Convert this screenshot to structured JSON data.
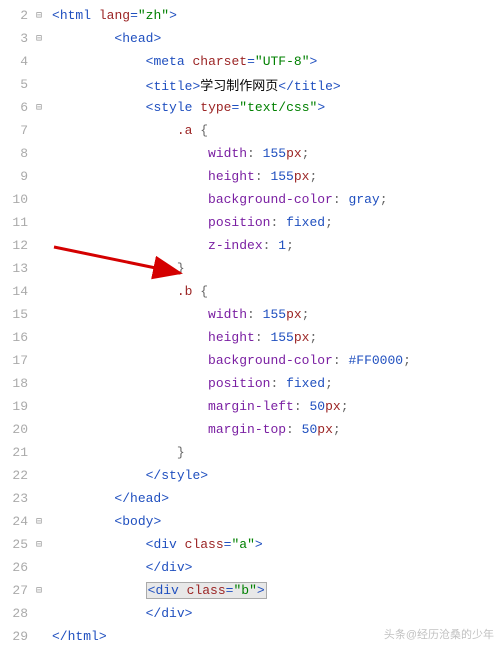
{
  "watermark": "头条@经历沧桑的少年",
  "lines": [
    {
      "num": "2",
      "fold": "⊟",
      "tokens": [
        [
          "",
          "<"
        ],
        [
          "tag",
          "html"
        ],
        [
          "",
          " "
        ],
        [
          "attr",
          "lang"
        ],
        [
          "",
          "="
        ],
        [
          "str",
          "\"zh\""
        ],
        [
          "",
          ">"
        ]
      ]
    },
    {
      "num": "3",
      "fold": "⊟",
      "indent": 2,
      "tokens": [
        [
          "",
          "<"
        ],
        [
          "tag",
          "head"
        ],
        [
          "",
          ">"
        ]
      ]
    },
    {
      "num": "4",
      "fold": "",
      "indent": 3,
      "tokens": [
        [
          "",
          "<"
        ],
        [
          "tag",
          "meta"
        ],
        [
          "",
          " "
        ],
        [
          "attr",
          "charset"
        ],
        [
          "",
          "="
        ],
        [
          "str",
          "\"UTF-8\""
        ],
        [
          "",
          ">"
        ]
      ]
    },
    {
      "num": "5",
      "fold": "",
      "indent": 3,
      "tokens": [
        [
          "",
          "<"
        ],
        [
          "tag",
          "title"
        ],
        [
          "",
          ">"
        ],
        [
          "text",
          "学习制作网页"
        ],
        [
          "",
          "</"
        ],
        [
          "tag",
          "title"
        ],
        [
          "",
          ">"
        ]
      ]
    },
    {
      "num": "6",
      "fold": "⊟",
      "indent": 3,
      "tokens": [
        [
          "",
          "<"
        ],
        [
          "tag",
          "style"
        ],
        [
          "",
          " "
        ],
        [
          "attr",
          "type"
        ],
        [
          "",
          "="
        ],
        [
          "str",
          "\"text/css\""
        ],
        [
          "",
          ">"
        ]
      ]
    },
    {
      "num": "7",
      "fold": "",
      "indent": 4,
      "tokens": [
        [
          "sel",
          ".a"
        ],
        [
          "",
          " "
        ],
        [
          "brace",
          "{"
        ]
      ]
    },
    {
      "num": "8",
      "fold": "",
      "indent": 5,
      "tokens": [
        [
          "prop",
          "width"
        ],
        [
          "colon",
          ": "
        ],
        [
          "val",
          "155"
        ],
        [
          "unit",
          "px"
        ],
        [
          "colon",
          ";"
        ]
      ]
    },
    {
      "num": "9",
      "fold": "",
      "indent": 5,
      "tokens": [
        [
          "prop",
          "height"
        ],
        [
          "colon",
          ": "
        ],
        [
          "val",
          "155"
        ],
        [
          "unit",
          "px"
        ],
        [
          "colon",
          ";"
        ]
      ]
    },
    {
      "num": "10",
      "fold": "",
      "indent": 5,
      "tokens": [
        [
          "prop",
          "background-color"
        ],
        [
          "colon",
          ": "
        ],
        [
          "val",
          "gray"
        ],
        [
          "colon",
          ";"
        ]
      ]
    },
    {
      "num": "11",
      "fold": "",
      "indent": 5,
      "tokens": [
        [
          "prop",
          "position"
        ],
        [
          "colon",
          ": "
        ],
        [
          "val",
          "fixed"
        ],
        [
          "colon",
          ";"
        ]
      ]
    },
    {
      "num": "12",
      "fold": "",
      "indent": 5,
      "tokens": [
        [
          "prop",
          "z-index"
        ],
        [
          "colon",
          ": "
        ],
        [
          "val",
          "1"
        ],
        [
          "colon",
          ";"
        ]
      ]
    },
    {
      "num": "13",
      "fold": "",
      "indent": 4,
      "tokens": [
        [
          "brace",
          "}"
        ]
      ]
    },
    {
      "num": "14",
      "fold": "",
      "indent": 4,
      "tokens": [
        [
          "sel",
          ".b"
        ],
        [
          "",
          " "
        ],
        [
          "brace",
          "{"
        ]
      ]
    },
    {
      "num": "15",
      "fold": "",
      "indent": 5,
      "tokens": [
        [
          "prop",
          "width"
        ],
        [
          "colon",
          ": "
        ],
        [
          "val",
          "155"
        ],
        [
          "unit",
          "px"
        ],
        [
          "colon",
          ";"
        ]
      ]
    },
    {
      "num": "16",
      "fold": "",
      "indent": 5,
      "tokens": [
        [
          "prop",
          "height"
        ],
        [
          "colon",
          ": "
        ],
        [
          "val",
          "155"
        ],
        [
          "unit",
          "px"
        ],
        [
          "colon",
          ";"
        ]
      ]
    },
    {
      "num": "17",
      "fold": "",
      "indent": 5,
      "tokens": [
        [
          "prop",
          "background-color"
        ],
        [
          "colon",
          ": "
        ],
        [
          "val",
          "#FF0000"
        ],
        [
          "colon",
          ";"
        ]
      ]
    },
    {
      "num": "18",
      "fold": "",
      "indent": 5,
      "tokens": [
        [
          "prop",
          "position"
        ],
        [
          "colon",
          ": "
        ],
        [
          "val",
          "fixed"
        ],
        [
          "colon",
          ";"
        ]
      ]
    },
    {
      "num": "19",
      "fold": "",
      "indent": 5,
      "tokens": [
        [
          "prop",
          "margin-left"
        ],
        [
          "colon",
          ": "
        ],
        [
          "val",
          "50"
        ],
        [
          "unit",
          "px"
        ],
        [
          "colon",
          ";"
        ]
      ]
    },
    {
      "num": "20",
      "fold": "",
      "indent": 5,
      "tokens": [
        [
          "prop",
          "margin-top"
        ],
        [
          "colon",
          ": "
        ],
        [
          "val",
          "50"
        ],
        [
          "unit",
          "px"
        ],
        [
          "colon",
          ";"
        ]
      ]
    },
    {
      "num": "21",
      "fold": "",
      "indent": 4,
      "tokens": [
        [
          "brace",
          "}"
        ]
      ]
    },
    {
      "num": "22",
      "fold": "",
      "indent": 3,
      "tokens": [
        [
          "",
          "</"
        ],
        [
          "tag",
          "style"
        ],
        [
          "",
          ">"
        ]
      ]
    },
    {
      "num": "23",
      "fold": "",
      "indent": 2,
      "tokens": [
        [
          "",
          "</"
        ],
        [
          "tag",
          "head"
        ],
        [
          "",
          ">"
        ]
      ]
    },
    {
      "num": "24",
      "fold": "⊟",
      "indent": 2,
      "tokens": [
        [
          "",
          "<"
        ],
        [
          "tag",
          "body"
        ],
        [
          "",
          ">"
        ]
      ]
    },
    {
      "num": "25",
      "fold": "⊟",
      "indent": 3,
      "tokens": [
        [
          "",
          "<"
        ],
        [
          "tag",
          "div"
        ],
        [
          "",
          " "
        ],
        [
          "attr",
          "class"
        ],
        [
          "",
          "="
        ],
        [
          "str",
          "\"a\""
        ],
        [
          "",
          ">"
        ]
      ]
    },
    {
      "num": "26",
      "fold": "",
      "indent": 3,
      "tokens": [
        [
          "",
          "</"
        ],
        [
          "tag",
          "div"
        ],
        [
          "",
          ">"
        ]
      ]
    },
    {
      "num": "27",
      "fold": "⊟",
      "indent": 3,
      "selected": true,
      "tokens": [
        [
          "",
          "<"
        ],
        [
          "tag",
          "div"
        ],
        [
          "",
          " "
        ],
        [
          "attr",
          "class"
        ],
        [
          "",
          "="
        ],
        [
          "str",
          "\"b\""
        ],
        [
          "",
          ">"
        ]
      ]
    },
    {
      "num": "28",
      "fold": "",
      "indent": 3,
      "tokens": [
        [
          "",
          "</"
        ],
        [
          "tag",
          "div"
        ],
        [
          "",
          ">"
        ]
      ]
    },
    {
      "num": "29",
      "fold": "",
      "indent": 0,
      "tokens": [
        [
          "",
          "</"
        ],
        [
          "tag",
          "html"
        ],
        [
          "",
          ">"
        ]
      ]
    }
  ]
}
